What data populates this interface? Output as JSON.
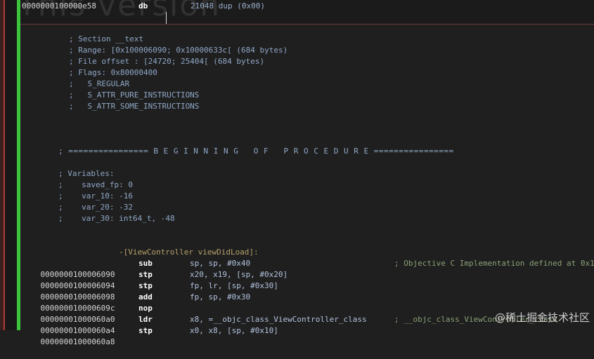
{
  "top": {
    "address": "0000000100000e58",
    "mnemonic": "db",
    "operands": "21048 dup (0x00)",
    "watermark": "This version"
  },
  "section_comments": [
    "; Section __text",
    "; Range: [0x100006090; 0x10000633c[ (684 bytes)",
    "; File offset : [24720; 25404[ (684 bytes)",
    "; Flags: 0x80000400",
    ";   S_REGULAR",
    ";   S_ATTR_PURE_INSTRUCTIONS",
    ";   S_ATTR_SOME_INSTRUCTIONS"
  ],
  "procedure_banner": "; ================ B E G I N N I N G   O F   P R O C E D U R E ================",
  "variables": [
    "; Variables:",
    ";    saved_fp: 0",
    ";    var_10: -16",
    ";    var_20: -32",
    ";    var_30: int64_t, -48"
  ],
  "procedure_name": "-[ViewController viewDidLoad]:",
  "instructions": [
    {
      "addr": "0000000100006090",
      "mn": "sub",
      "ops": "sp, sp, #0x40",
      "comment": "; Objective C Implementation defined at 0x1"
    },
    {
      "addr": "0000000100006094",
      "mn": "stp",
      "ops": "x20, x19, [sp, #0x20]",
      "comment": ""
    },
    {
      "addr": "0000000100006098",
      "mn": "stp",
      "ops": "fp, lr, [sp, #0x30]",
      "comment": ""
    },
    {
      "addr": "000000010000609c",
      "mn": "add",
      "ops": "fp, sp, #0x30",
      "comment": ""
    },
    {
      "addr": "00000001000060a0",
      "mn": "nop",
      "ops": "",
      "comment": ""
    },
    {
      "addr": "00000001000060a4",
      "mn": "ldr",
      "ops": "x8, =__objc_class_ViewController_class",
      "comment": "; __objc_class_ViewController_class"
    },
    {
      "addr": "00000001000060a8",
      "mn": "stp",
      "ops": "x0, x8, [sp, #0x10]",
      "comment": ""
    }
  ],
  "watermark_cn": "@稀土掘金技术社区"
}
